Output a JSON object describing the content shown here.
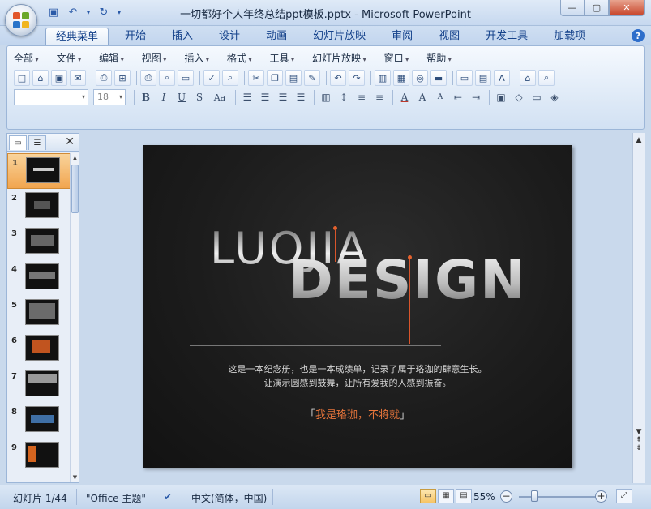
{
  "window": {
    "title": "一切都好个人年终总结ppt模板.pptx - Microsoft PowerPoint",
    "controls": {
      "minimize": "—",
      "maximize": "▢",
      "close": "✕"
    }
  },
  "quick_access": {
    "save_icon": "save-icon",
    "undo_icon": "undo-icon",
    "redo_icon": "redo-icon"
  },
  "tabs": [
    "经典菜单",
    "开始",
    "插入",
    "设计",
    "动画",
    "幻灯片放映",
    "审阅",
    "视图",
    "开发工具",
    "加载项"
  ],
  "active_tab": "经典菜单",
  "classic_menu": [
    "全部",
    "文件",
    "编辑",
    "视图",
    "插入",
    "格式",
    "工具",
    "幻灯片放映",
    "窗口",
    "帮助"
  ],
  "font": {
    "name_value": "",
    "size_value": "18"
  },
  "slide_panel": {
    "slides": [
      "1",
      "2",
      "3",
      "4",
      "5",
      "6",
      "7",
      "8",
      "9"
    ],
    "selected": "1"
  },
  "slide": {
    "luojia": "LUOJIA",
    "design": "DESIGN",
    "desc_line1": "这是一本纪念册，也是一本成绩单，记录了属于珞珈的肆意生长。",
    "desc_line2": "让演示圆感到鼓舞，让所有爱我的人感到振奋。",
    "quote_open": "「",
    "quote_text": "我是珞珈，不将就",
    "quote_close": "」",
    "accent_color": "#e9763b"
  },
  "status": {
    "slide_info": "幻灯片 1/44",
    "theme": "\"Office 主题\"",
    "language": "中文(简体，中国)",
    "zoom": "55%"
  }
}
